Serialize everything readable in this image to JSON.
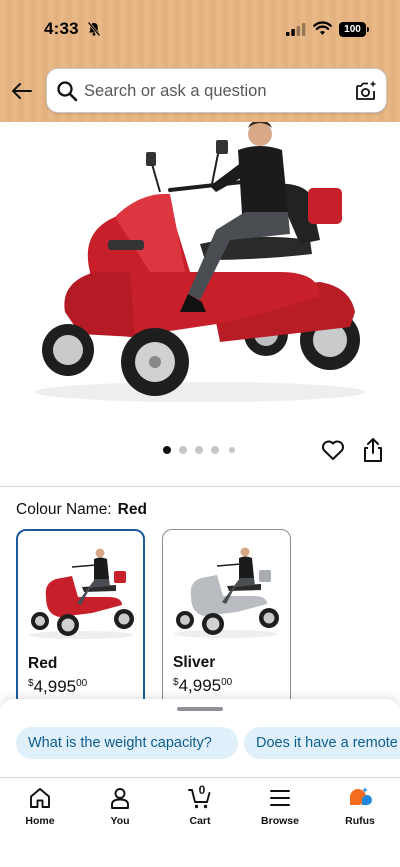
{
  "status_bar": {
    "time": "4:33",
    "battery": "100"
  },
  "header": {
    "search_placeholder": "Search or ask a question",
    "background_color": "#e8b886"
  },
  "gallery": {
    "image_count": 5,
    "active_index": 0
  },
  "variation": {
    "label": "Colour Name:",
    "selected_value": "Red",
    "options": [
      {
        "name": "Red",
        "currency": "$",
        "price_whole": "4,995",
        "price_fraction": "00",
        "selected": true
      },
      {
        "name": "Sliver",
        "currency": "$",
        "price_whole": "4,995",
        "price_fraction": "00",
        "selected": false
      }
    ]
  },
  "rufus_suggestions": [
    "What is the weight capacity?",
    "Does it have a remote"
  ],
  "tabbar": {
    "items": [
      {
        "label": "Home",
        "icon": "home-icon"
      },
      {
        "label": "You",
        "icon": "person-icon"
      },
      {
        "label": "Cart",
        "icon": "cart-icon"
      },
      {
        "label": "Browse",
        "icon": "menu-icon"
      },
      {
        "label": "Rufus",
        "icon": "rufus-icon"
      }
    ],
    "cart_count": "0"
  },
  "colors": {
    "accent_blue": "#1d5a9c",
    "chip_bg": "#dff0fb",
    "chip_text": "#0e5e8c",
    "scooter_red": "#c8202a",
    "scooter_silver": "#b9bcc0"
  }
}
